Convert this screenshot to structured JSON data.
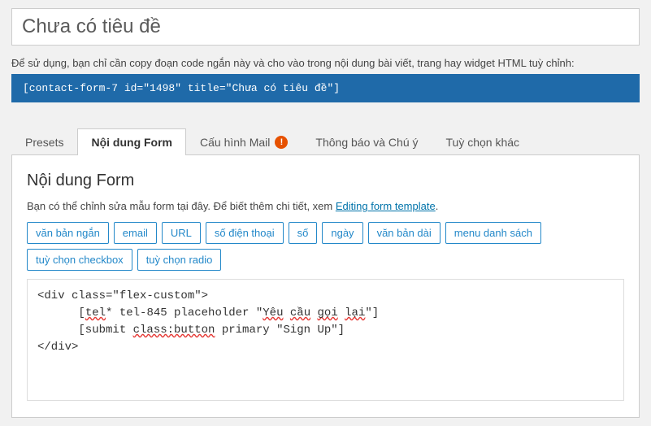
{
  "title": "Chưa có tiêu đề",
  "usageNote": "Để sử dụng, bạn chỉ cần copy đoạn code ngắn này và cho vào trong nội dung bài viết, trang hay widget HTML tuỳ chỉnh:",
  "shortcode": "[contact-form-7 id=\"1498\" title=\"Chưa có tiêu đề\"]",
  "tabs": {
    "presets": "Presets",
    "form": "Nội dung Form",
    "mail": "Cấu hình Mail",
    "messages": "Thông báo và Chú ý",
    "additional": "Tuỳ chọn khác"
  },
  "panel": {
    "heading": "Nội dung Form",
    "descPrefix": "Bạn có thể chỉnh sửa mẫu form tại đây. Để biết thêm chi tiết, xem ",
    "descLink": "Editing form template",
    "descSuffix": "."
  },
  "tagButtons": {
    "text": "văn bản ngắn",
    "email": "email",
    "url": "URL",
    "tel": "số điện thoại",
    "number": "số",
    "date": "ngày",
    "textarea": "văn bản dài",
    "select": "menu danh sách",
    "checkbox": "tuỳ chọn checkbox",
    "radio": "tuỳ chọn radio"
  },
  "code": {
    "l1a": "<div class=\"flex-custom\">",
    "l2a": "      [",
    "l2b": "tel",
    "l2c": "* tel-845 placeholder \"",
    "l2d": "Yêu",
    "l2e": " ",
    "l2f": "cầu",
    "l2g": " ",
    "l2h": "gọi",
    "l2i": " ",
    "l2j": "lại",
    "l2k": "\"]",
    "l3a": "      [submit ",
    "l3b": "class:button",
    "l3c": " primary \"Sign Up\"]",
    "l4a": "</div>"
  }
}
